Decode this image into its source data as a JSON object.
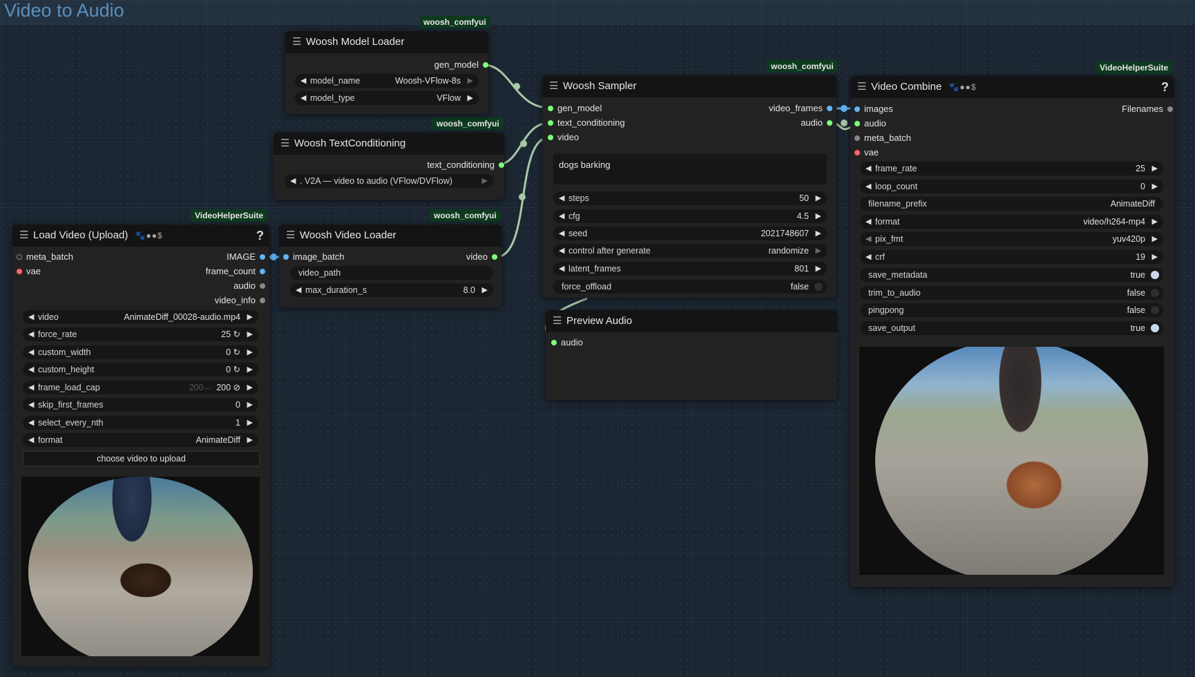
{
  "group": {
    "title": "Video to Audio"
  },
  "badges": {
    "woosh": "woosh_comfyui",
    "vhs": "VideoHelperSuite"
  },
  "model_loader": {
    "title": "Woosh Model Loader",
    "out_gen_model": "gen_model",
    "model_name_label": "model_name",
    "model_name_value": "Woosh-VFlow-8s",
    "model_type_label": "model_type",
    "model_type_value": "VFlow"
  },
  "text_cond": {
    "title": "Woosh TextConditioning",
    "out_text_conditioning": "text_conditioning",
    "combo_value": ". V2A — video to audio (VFlow/DVFlow)"
  },
  "video_loader": {
    "title": "Woosh Video Loader",
    "in_image_batch": "image_batch",
    "out_video": "video",
    "video_path_label": "video_path",
    "max_duration_label": "max_duration_s",
    "max_duration_value": "8.0"
  },
  "sampler": {
    "title": "Woosh Sampler",
    "in_gen_model": "gen_model",
    "in_text_conditioning": "text_conditioning",
    "in_video": "video",
    "out_video_frames": "video_frames",
    "out_audio": "audio",
    "prompt": "dogs barking",
    "widgets": [
      {
        "label": "steps",
        "value": "50"
      },
      {
        "label": "cfg",
        "value": "4.5"
      },
      {
        "label": "seed",
        "value": "2021748607"
      },
      {
        "label": "control after generate",
        "value": "randomize"
      },
      {
        "label": "latent_frames",
        "value": "801"
      },
      {
        "label": "force_offload",
        "value": "false"
      }
    ]
  },
  "preview_audio": {
    "title": "Preview Audio",
    "in_audio": "audio"
  },
  "load_video": {
    "title": "Load Video (Upload)",
    "icons": "🐾●●$",
    "help": "?",
    "in_meta_batch": "meta_batch",
    "in_vae": "vae",
    "out_image": "IMAGE",
    "out_frame_count": "frame_count",
    "out_audio": "audio",
    "out_video_info": "video_info",
    "widgets": [
      {
        "label": "video",
        "value": "AnimateDiff_00028-audio.mp4"
      },
      {
        "label": "force_rate",
        "value": "25 ↻"
      },
      {
        "label": "custom_width",
        "value": "0 ↻"
      },
      {
        "label": "custom_height",
        "value": "0 ↻"
      },
      {
        "label": "frame_load_cap",
        "value": "200 ⊘",
        "dim": "200←"
      },
      {
        "label": "skip_first_frames",
        "value": "0"
      },
      {
        "label": "select_every_nth",
        "value": "1"
      },
      {
        "label": "format",
        "value": "AnimateDiff"
      }
    ],
    "upload_button": "choose video to upload"
  },
  "video_combine": {
    "title": "Video Combine",
    "icons": "🐾●●$",
    "help": "?",
    "in_images": "images",
    "in_audio": "audio",
    "in_meta_batch": "meta_batch",
    "in_vae": "vae",
    "out_filenames": "Filenames",
    "widgets": [
      {
        "label": "frame_rate",
        "value": "25"
      },
      {
        "label": "loop_count",
        "value": "0"
      },
      {
        "label": "filename_prefix",
        "value": "AnimateDiff"
      },
      {
        "label": "format",
        "value": "video/h264-mp4"
      },
      {
        "label": "pix_fmt",
        "value": "yuv420p"
      },
      {
        "label": "crf",
        "value": "19"
      },
      {
        "label": "save_metadata",
        "value": "true"
      },
      {
        "label": "trim_to_audio",
        "value": "false"
      },
      {
        "label": "pingpong",
        "value": "false"
      },
      {
        "label": "save_output",
        "value": "true"
      }
    ]
  },
  "colors": {
    "canvas": "#1b2632",
    "node": "#222222",
    "title_bar": "#141414",
    "badge": "#0e3a1e",
    "link": "#a8c8a8",
    "image_link": "#64b5f6"
  },
  "icons": {
    "menu": "hamburger-icon",
    "left": "arrow-left-icon",
    "right": "arrow-right-icon"
  }
}
